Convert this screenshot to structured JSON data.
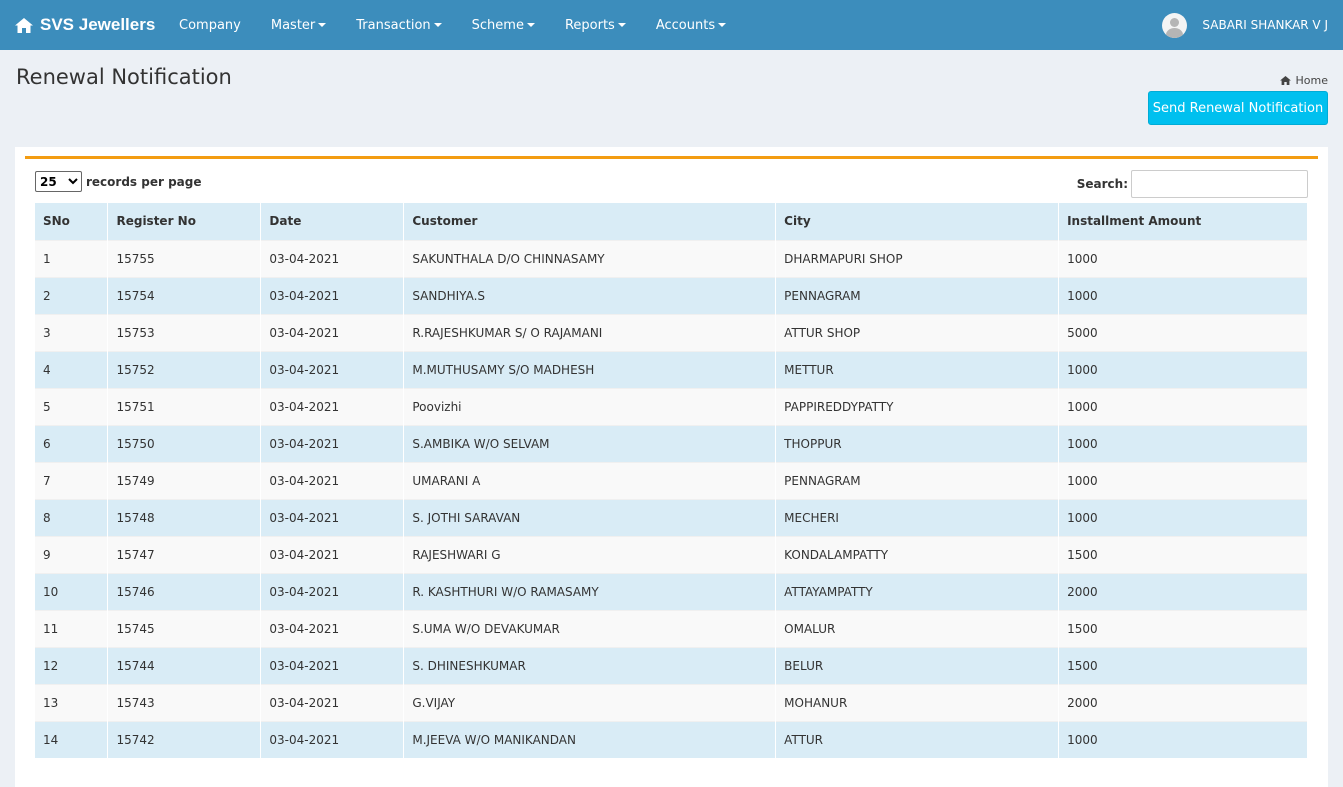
{
  "navbar": {
    "brand": "SVS Jewellers",
    "brand_icon": "home-icon",
    "menu": [
      {
        "label": "Company",
        "dropdown": false
      },
      {
        "label": "Master",
        "dropdown": true
      },
      {
        "label": "Transaction",
        "dropdown": true
      },
      {
        "label": "Scheme",
        "dropdown": true
      },
      {
        "label": "Reports",
        "dropdown": true
      },
      {
        "label": "Accounts",
        "dropdown": true
      }
    ],
    "user_name": "SABARI SHANKAR V J"
  },
  "page": {
    "title": "Renewal Notification",
    "breadcrumb_home": "Home",
    "send_button": "Send Renewal Notification"
  },
  "table_controls": {
    "page_length_value": "25",
    "records_label": "records per page",
    "search_label": "Search:",
    "search_value": ""
  },
  "table": {
    "columns": [
      "SNo",
      "Register No",
      "Date",
      "Customer",
      "City",
      "Installment Amount"
    ],
    "rows": [
      [
        "1",
        "15755",
        "03-04-2021",
        "SAKUNTHALA D/O CHINNASAMY",
        "DHARMAPURI SHOP",
        "1000"
      ],
      [
        "2",
        "15754",
        "03-04-2021",
        "SANDHIYA.S",
        "PENNAGRAM",
        "1000"
      ],
      [
        "3",
        "15753",
        "03-04-2021",
        "R.RAJESHKUMAR S/ O RAJAMANI",
        "ATTUR SHOP",
        "5000"
      ],
      [
        "4",
        "15752",
        "03-04-2021",
        "M.MUTHUSAMY S/O MADHESH",
        "METTUR",
        "1000"
      ],
      [
        "5",
        "15751",
        "03-04-2021",
        "Poovizhi",
        "PAPPIREDDYPATTY",
        "1000"
      ],
      [
        "6",
        "15750",
        "03-04-2021",
        "S.AMBIKA W/O SELVAM",
        "THOPPUR",
        "1000"
      ],
      [
        "7",
        "15749",
        "03-04-2021",
        "UMARANI A",
        "PENNAGRAM",
        "1000"
      ],
      [
        "8",
        "15748",
        "03-04-2021",
        "S. JOTHI SARAVAN",
        "MECHERI",
        "1000"
      ],
      [
        "9",
        "15747",
        "03-04-2021",
        "RAJESHWARI G",
        "KONDALAMPATTY",
        "1500"
      ],
      [
        "10",
        "15746",
        "03-04-2021",
        "R. KASHTHURI W/O RAMASAMY",
        "ATTAYAMPATTY",
        "2000"
      ],
      [
        "11",
        "15745",
        "03-04-2021",
        "S.UMA W/O DEVAKUMAR",
        "OMALUR",
        "1500"
      ],
      [
        "12",
        "15744",
        "03-04-2021",
        "S. DHINESHKUMAR",
        "BELUR",
        "1500"
      ],
      [
        "13",
        "15743",
        "03-04-2021",
        "G.VIJAY",
        "MOHANUR",
        "2000"
      ],
      [
        "14",
        "15742",
        "03-04-2021",
        "M.JEEVA W/O MANIKANDAN",
        "ATTUR",
        "1000"
      ]
    ]
  },
  "colors": {
    "navbar": "#3c8dbc",
    "accent_line": "#f39c12",
    "button": "#00c0ef",
    "row_highlight": "#d9ecf6"
  }
}
